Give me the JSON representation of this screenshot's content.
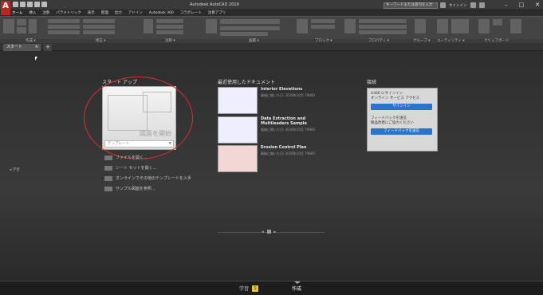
{
  "titlebar": {
    "app_letter": "A",
    "title": "Autodesk AutoCAD 2019",
    "search_placeholder": "キーワードまたは語句を入力",
    "signin": "サインイン",
    "window_controls": [
      "–",
      "□",
      "✕"
    ]
  },
  "ribbon_tabs": [
    "ホーム",
    "挿入",
    "注釈",
    "パラメトリック",
    "表示",
    "管理",
    "出力",
    "アドイン",
    "Autodesk 360",
    "コラボレート",
    "注目アプリ"
  ],
  "ribbon_panel_labels": [
    "作成 ▾",
    "修正 ▾",
    "注釈 ▾",
    "画層 ▾",
    "ブロック ▾",
    "プロパティ ▾",
    "グループ ▾",
    "ユーティリティ ▾",
    "クリップボード"
  ],
  "doc_tab": {
    "label": "スタート",
    "close": "×",
    "new_tab": "+"
  },
  "left_nav": {
    "label": "◂ 学習"
  },
  "start_column": {
    "heading": "スタート アップ",
    "tile_label": "図面を開始",
    "template_selector": "テンプレート",
    "links": [
      "ファイルを開く...",
      "シート セットを開く...",
      "オンラインでその他のテンプレートを入手",
      "サンプル図面を参照..."
    ]
  },
  "recent_column": {
    "heading": "最近使用したドキュメント",
    "items": [
      {
        "title": "Interior Elevations",
        "meta": "最後に開いた日: 2018年10月 79800"
      },
      {
        "title": "Data Extraction and Multileaders Sample",
        "meta": "最後に開いた日: 2018年10月 79800"
      },
      {
        "title": "Erosion Control Plan",
        "meta": "最後に開いた日: 2018年10月 79800"
      }
    ],
    "pager": [
      "◂",
      "▸"
    ]
  },
  "connect_column": {
    "heading": "接続",
    "text1": "A360 にサインイン",
    "text2": "オンライン サービス アクセス",
    "signin_button": "サインイン",
    "text3": "フィードバックを送信",
    "text4": "製品改善にご協力ください",
    "feedback_button": "フィードバックを送信"
  },
  "bottom_bar": {
    "learn": "学習",
    "learn_badge": "1",
    "create": "作成"
  },
  "colors": {
    "accent_red": "#d8302a",
    "button_blue": "#2a74c9",
    "badge_yellow": "#e8c22f"
  }
}
